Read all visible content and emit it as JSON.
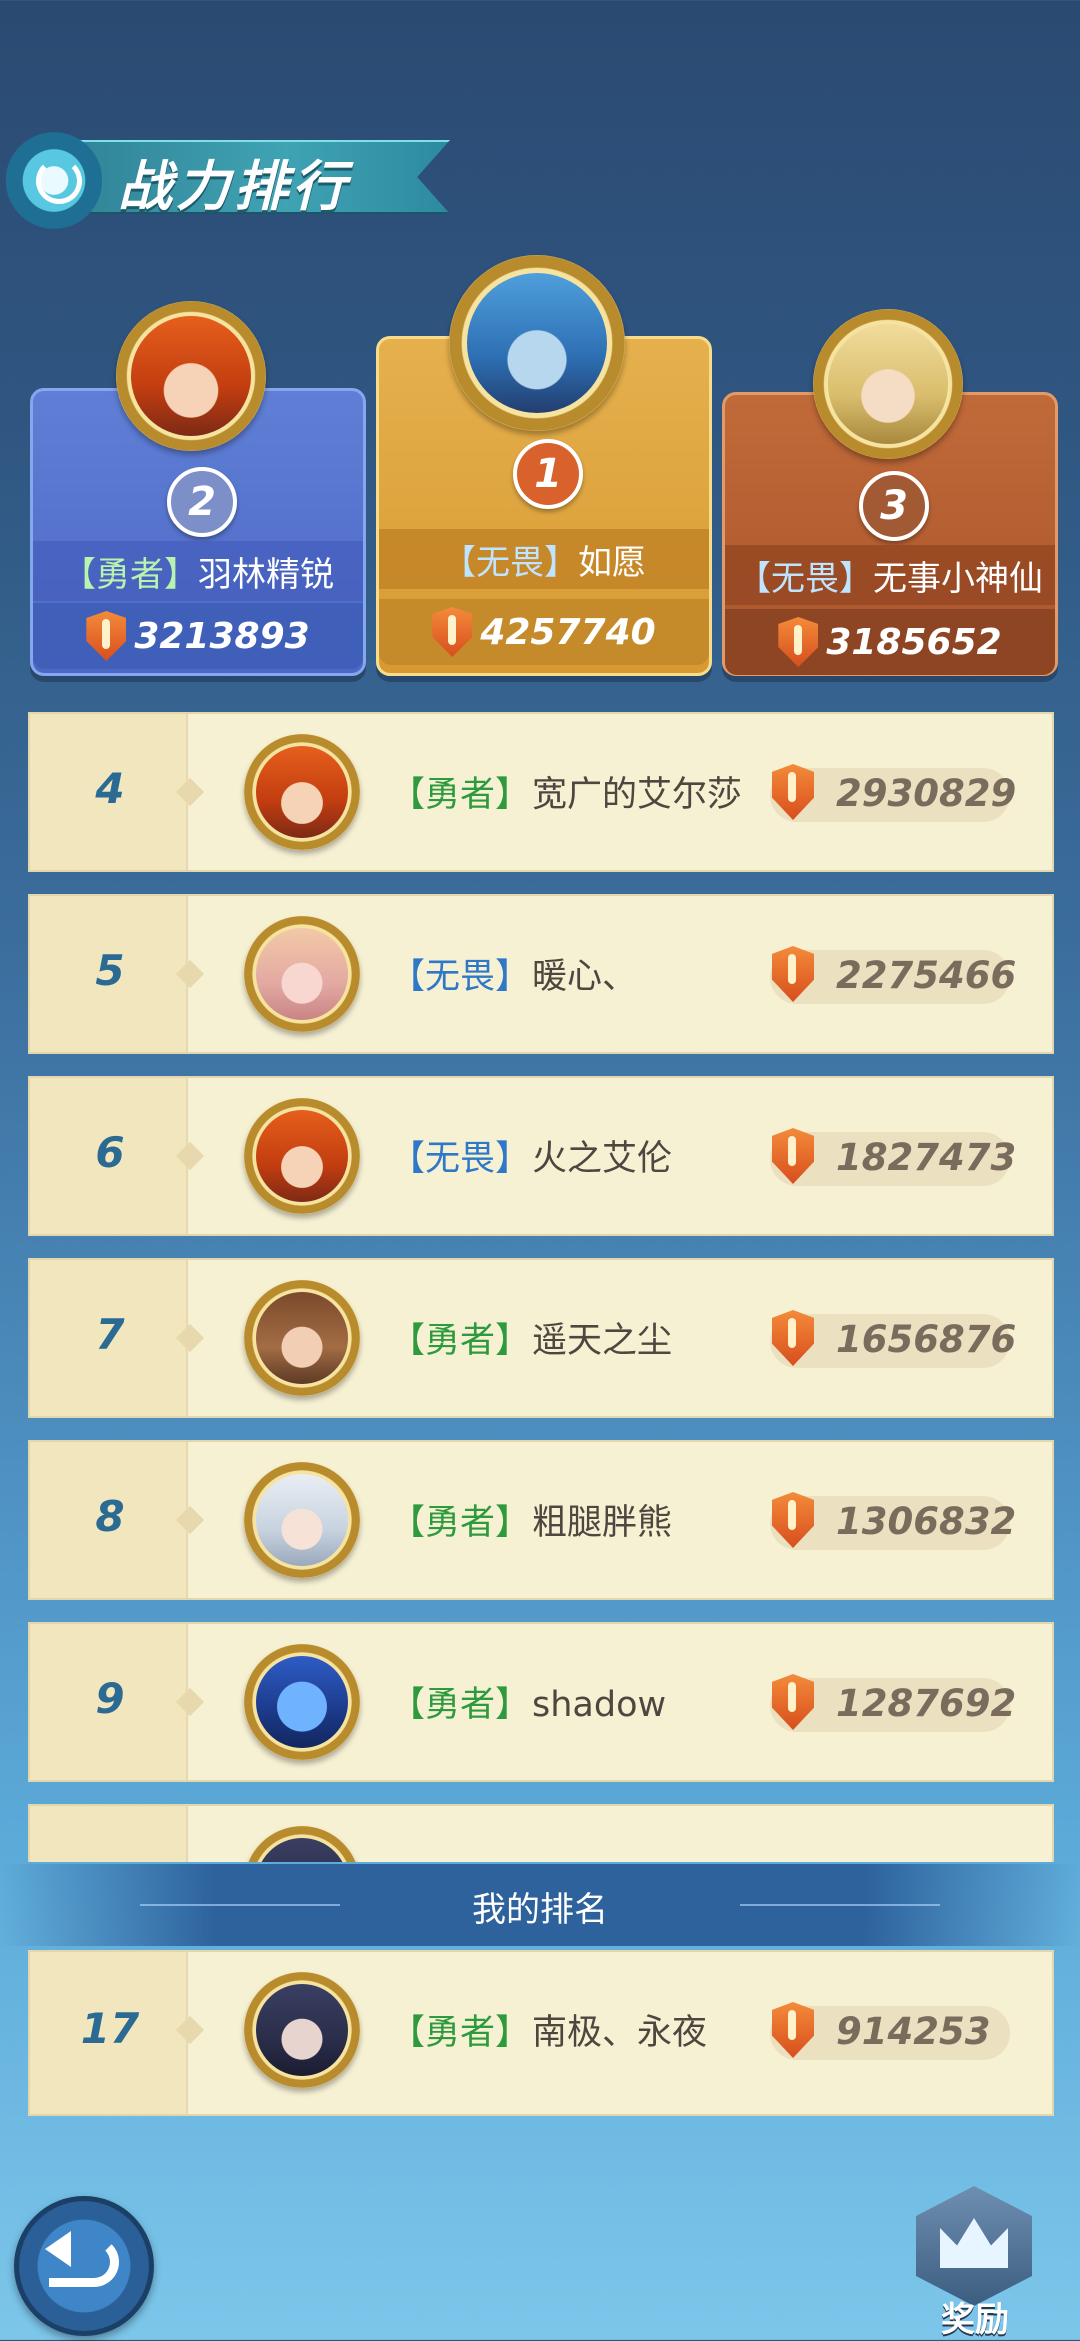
{
  "header": {
    "title": "战力排行"
  },
  "podium": [
    {
      "rank": "2",
      "tag": "【勇者】",
      "name": "羽林精锐",
      "power": "3213893"
    },
    {
      "rank": "1",
      "tag": "【无畏】",
      "name": "如愿",
      "power": "4257740"
    },
    {
      "rank": "3",
      "tag": "【无畏】",
      "name": "无事小神仙",
      "power": "3185652"
    }
  ],
  "ranking": [
    {
      "rank": "4",
      "tag": "【勇者】",
      "name": "宽广的艾尔莎",
      "power": "2930829"
    },
    {
      "rank": "5",
      "tag": "【无畏】",
      "name": "暖心、",
      "power": "2275466"
    },
    {
      "rank": "6",
      "tag": "【无畏】",
      "name": "火之艾伦",
      "power": "1827473"
    },
    {
      "rank": "7",
      "tag": "【勇者】",
      "name": "遥天之尘",
      "power": "1656876"
    },
    {
      "rank": "8",
      "tag": "【勇者】",
      "name": "粗腿胖熊",
      "power": "1306832"
    },
    {
      "rank": "9",
      "tag": "【勇者】",
      "name": "shadow",
      "power": "1287692"
    }
  ],
  "my_rank": {
    "label": "我的排名",
    "rank": "17",
    "tag": "【勇者】",
    "name": "南极、永夜",
    "power": "914253"
  },
  "footer": {
    "reward_label": "奖励"
  }
}
